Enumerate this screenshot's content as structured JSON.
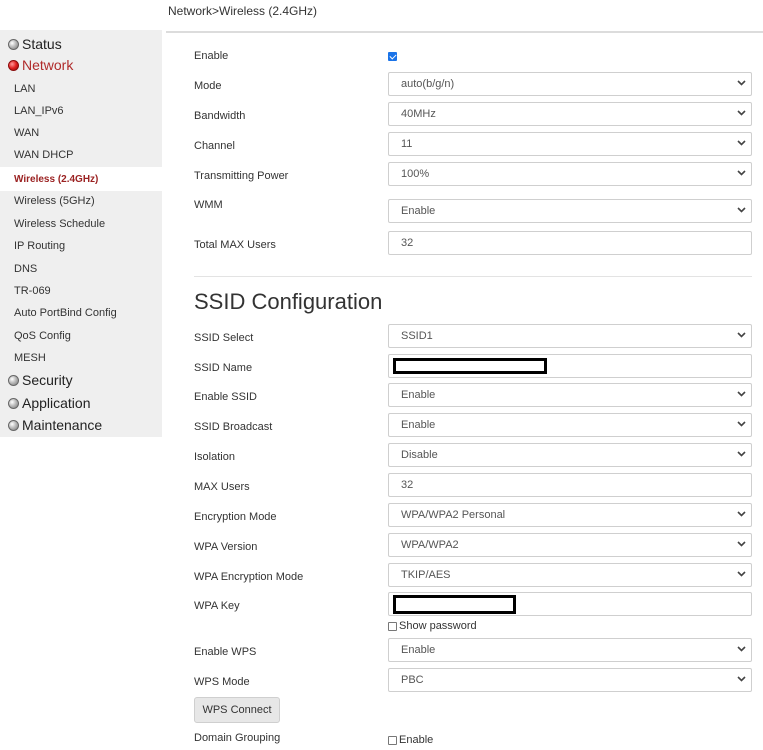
{
  "breadcrumb": "Network>Wireless (2.4GHz)",
  "sidebar": {
    "heads": [
      {
        "label": "Status",
        "color": "#777777"
      },
      {
        "label": "Network",
        "color": "#e02020"
      },
      {
        "label": "Security",
        "color": "#777777"
      },
      {
        "label": "Application",
        "color": "#777777"
      },
      {
        "label": "Maintenance",
        "color": "#777777"
      }
    ],
    "items": [
      "LAN",
      "LAN_IPv6",
      "WAN",
      "WAN DHCP",
      "Wireless (2.4GHz)",
      "Wireless (5GHz)",
      "Wireless Schedule",
      "IP Routing",
      "DNS",
      "TR-069",
      "Auto PortBind Config",
      "QoS Config",
      "MESH"
    ],
    "active_item": "Wireless (2.4GHz)"
  },
  "wireless": {
    "enable_label": "Enable",
    "enable_checked": true,
    "mode_label": "Mode",
    "mode_value": "auto(b/g/n)",
    "bandwidth_label": "Bandwidth",
    "bandwidth_value": "40MHz",
    "channel_label": "Channel",
    "channel_value": "11",
    "power_label": "Transmitting Power",
    "power_value": "100%",
    "wmm_label": "WMM",
    "wmm_value": "Enable",
    "max_users_label": "Total MAX Users",
    "max_users_value": "32"
  },
  "ssid": {
    "title": "SSID Configuration",
    "select_label": "SSID Select",
    "select_value": "SSID1",
    "name_label": "SSID Name",
    "enable_label": "Enable SSID",
    "enable_value": "Enable",
    "broadcast_label": "SSID Broadcast",
    "broadcast_value": "Enable",
    "isolation_label": "Isolation",
    "isolation_value": "Disable",
    "max_users_label": "MAX Users",
    "max_users_value": "32",
    "encryption_label": "Encryption Mode",
    "encryption_value": "WPA/WPA2 Personal",
    "wpa_version_label": "WPA Version",
    "wpa_version_value": "WPA/WPA2",
    "wpa_enc_label": "WPA Encryption Mode",
    "wpa_enc_value": "TKIP/AES",
    "wpa_key_label": "WPA Key",
    "show_password_label": "Show password",
    "wps_enable_label": "Enable WPS",
    "wps_enable_value": "Enable",
    "wps_mode_label": "WPS Mode",
    "wps_mode_value": "PBC",
    "wps_connect_label": "WPS Connect",
    "domain_grouping_label": "Domain Grouping",
    "domain_grouping_enable_label": "Enable"
  }
}
